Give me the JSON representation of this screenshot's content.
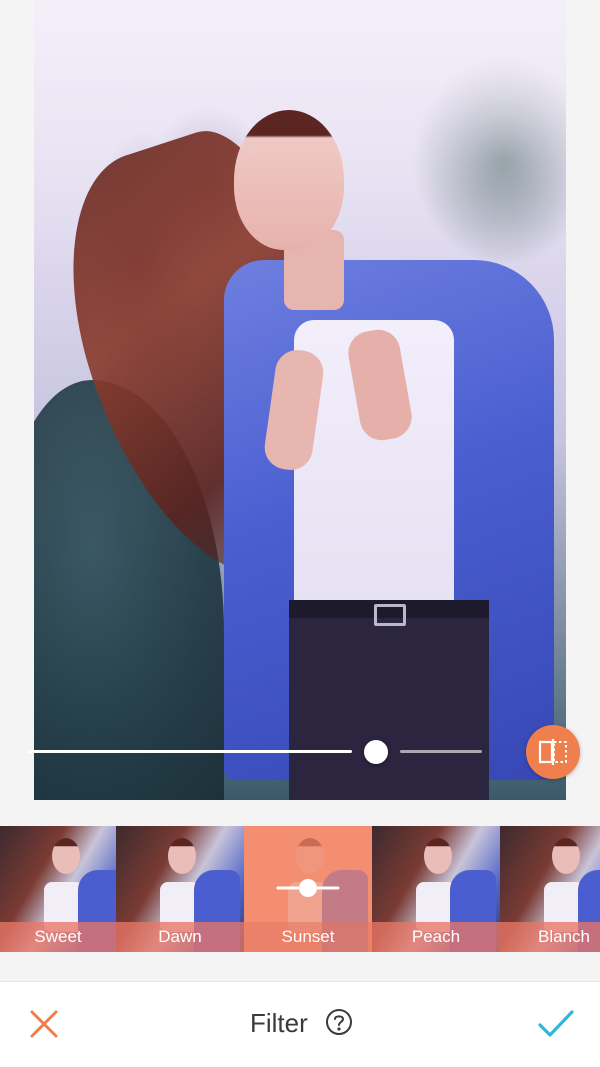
{
  "photo_editor": {
    "photo": {
      "description_icon": "photo"
    },
    "intensity_slider": {
      "value_fraction": 0.79
    },
    "compare_button": {
      "icon": "split-compare-icon",
      "color": "#f07f4e"
    }
  },
  "filters": [
    {
      "name": "Sweet",
      "selected": false
    },
    {
      "name": "Dawn",
      "selected": false
    },
    {
      "name": "Sunset",
      "selected": true
    },
    {
      "name": "Peach",
      "selected": false
    },
    {
      "name": "Blanch",
      "selected": false
    }
  ],
  "bottom_bar": {
    "title": "Filter",
    "close_icon": "close-icon",
    "confirm_icon": "check-icon",
    "help_icon": "help-icon",
    "accent_color": "#f07f4e",
    "confirm_color": "#2bb8d9"
  }
}
